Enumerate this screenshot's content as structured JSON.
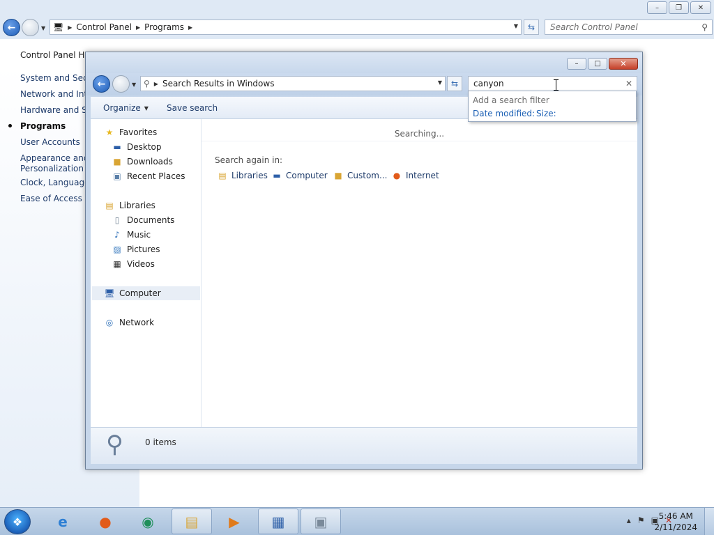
{
  "background_window": {
    "breadcrumb": [
      "Control Panel",
      "Programs"
    ],
    "search_placeholder": "Search Control Panel",
    "sidebar": [
      {
        "label": "Control Panel Hon"
      },
      {
        "label": "System and Secur"
      },
      {
        "label": "Network and Inter"
      },
      {
        "label": "Hardware and Sou"
      },
      {
        "label": "Programs",
        "active": true
      },
      {
        "label": "User Accounts"
      },
      {
        "label": "Appearance and"
      },
      {
        "label": "Personalization"
      },
      {
        "label": "Clock, Language,"
      },
      {
        "label": "Ease of Access"
      }
    ]
  },
  "explorer": {
    "address": "Search Results in Windows",
    "search_value": "canyon",
    "toolbar": {
      "organize": "Organize",
      "save_search": "Save search"
    },
    "nav_pane": {
      "favorites": "Favorites",
      "desktop": "Desktop",
      "downloads": "Downloads",
      "recent_places": "Recent Places",
      "libraries": "Libraries",
      "documents": "Documents",
      "music": "Music",
      "pictures": "Pictures",
      "videos": "Videos",
      "computer": "Computer",
      "network": "Network"
    },
    "status_text": "Searching...",
    "search_again_label": "Search again in:",
    "search_again": {
      "libraries": "Libraries",
      "computer": "Computer",
      "custom": "Custom...",
      "internet": "Internet"
    },
    "details": {
      "items": "0 items"
    },
    "filter_dropdown": {
      "title": "Add a search filter",
      "date_modified": "Date modified:",
      "size": "Size:"
    }
  },
  "taskbar": {
    "time": "5:46 AM",
    "date": "2/11/2024"
  },
  "colors": {
    "link": "#1e3b6a",
    "filter_link": "#1a5fb4",
    "chrome": "#dfe9f5",
    "close_red": "#c54029"
  }
}
